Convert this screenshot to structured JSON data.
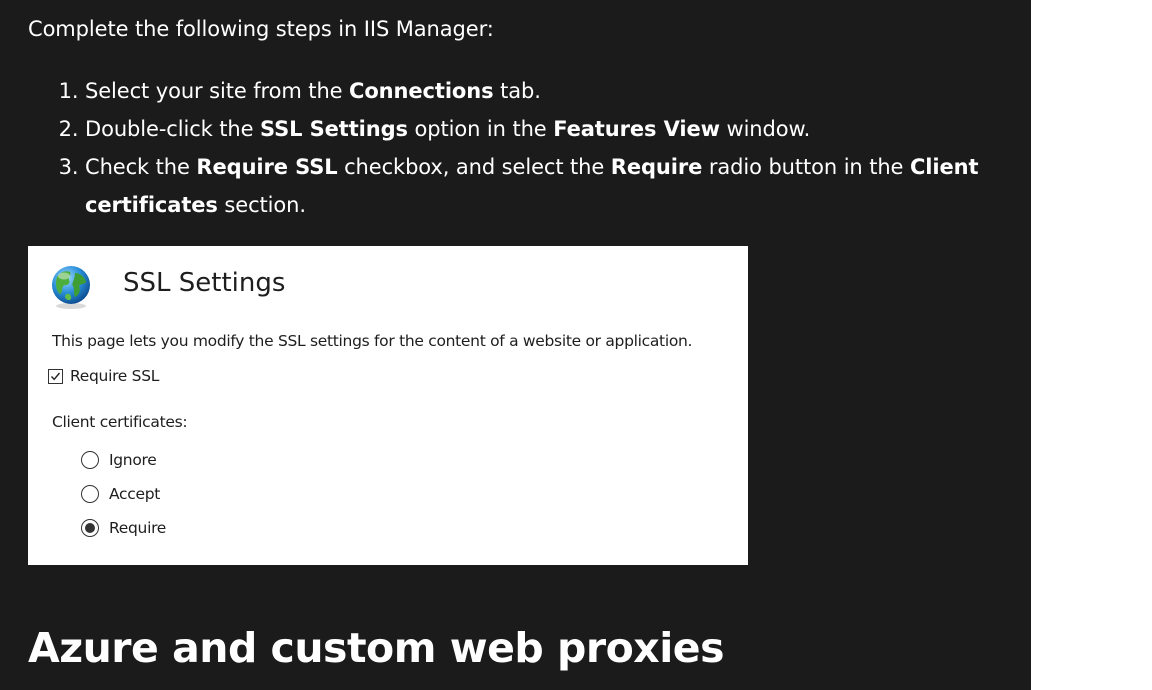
{
  "intro": "Complete the following steps in IIS Manager:",
  "steps": [
    {
      "t0": "Select your site from the ",
      "b0": "Connections",
      "t1": " tab."
    },
    {
      "t0": "Double-click the ",
      "b0": "SSL Settings",
      "t1": " option in the ",
      "b1": "Features View",
      "t2": " window."
    },
    {
      "t0": "Check the ",
      "b0": "Require SSL",
      "t1": " checkbox, and select the ",
      "b1": "Require",
      "t2": " radio button in the ",
      "b2": "Client certificates",
      "t3": " section."
    }
  ],
  "ssl_panel": {
    "icon": "globe-icon",
    "title": "SSL Settings",
    "description": "This page lets you modify the SSL settings for the content of a website or application.",
    "require_ssl_label": "Require SSL",
    "require_ssl_checked": true,
    "client_certificates_label": "Client certificates:",
    "options": [
      {
        "label": "Ignore",
        "selected": false
      },
      {
        "label": "Accept",
        "selected": false
      },
      {
        "label": "Require",
        "selected": true
      }
    ]
  },
  "section_heading": "Azure and custom web proxies",
  "colors": {
    "page_background": "#1b1b1b",
    "text": "#ffffff",
    "panel_background": "#ffffff"
  }
}
